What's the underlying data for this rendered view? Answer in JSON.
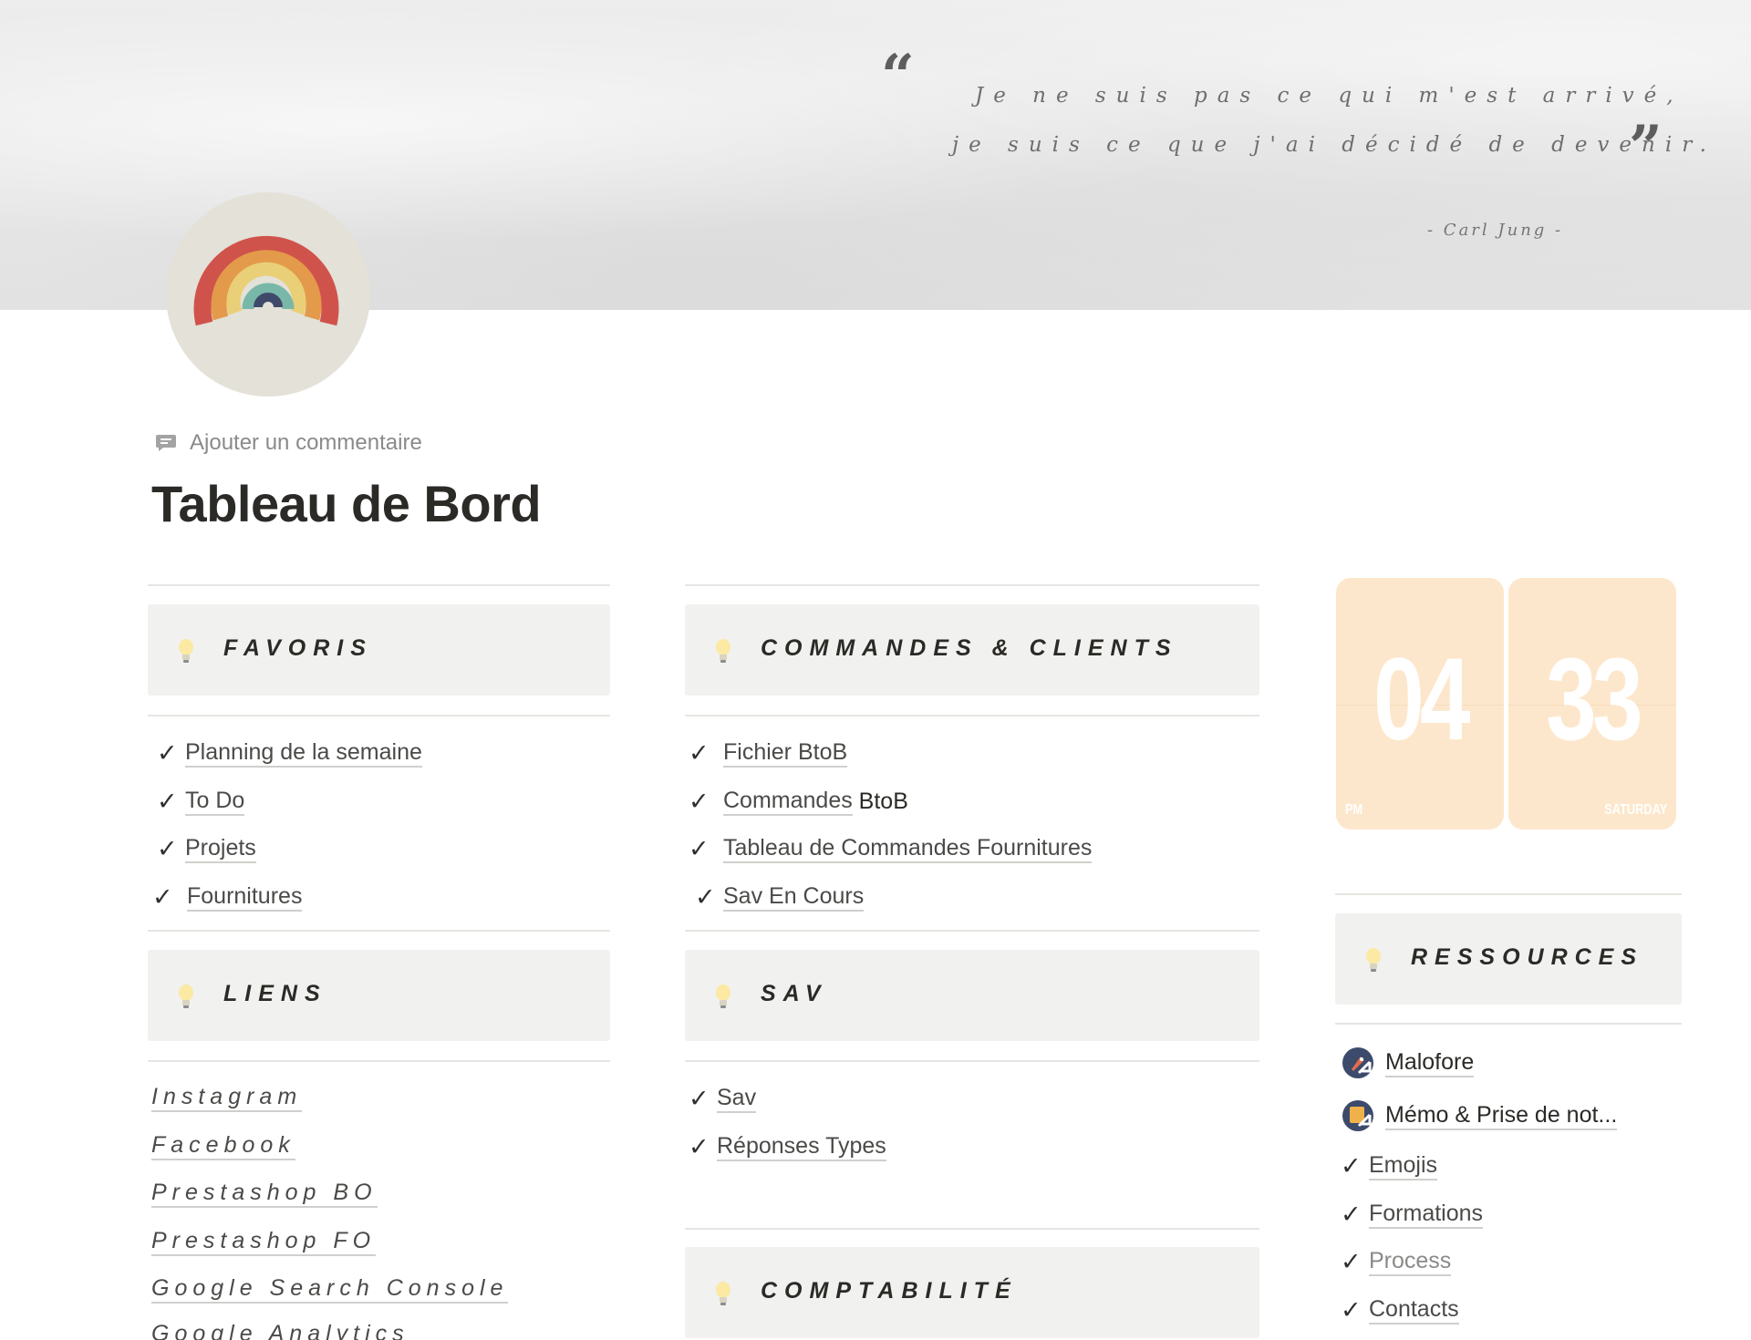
{
  "cover": {
    "quote_line1": "Je ne suis pas ce qui m'est arrivé,",
    "quote_line2": "je suis ce que j'ai décidé de devenir.",
    "quote_author": "- Carl Jung -",
    "quote_open": "“",
    "quote_close": "”"
  },
  "page": {
    "icon": "rainbow-icon",
    "comment_label": "Ajouter un commentaire",
    "title": "Tableau de Bord"
  },
  "favoris": {
    "title": "FAVORIS",
    "items": [
      "Planning de la semaine",
      "To Do",
      "Projets",
      "Fournitures"
    ]
  },
  "liens": {
    "title": "LIENS",
    "items": [
      "Instagram",
      "Facebook",
      "Prestashop BO",
      "Prestashop FO",
      "Google Search Console",
      "Google Analytics"
    ]
  },
  "commandes": {
    "title": "COMMANDES & CLIENTS",
    "items": [
      {
        "link": "Fichier BtoB",
        "suffix": ""
      },
      {
        "link": "Commandes",
        "suffix": " BtoB"
      },
      {
        "link": "Tableau de Commandes Fournitures",
        "suffix": ""
      },
      {
        "link": "Sav En Cours",
        "suffix": ""
      }
    ]
  },
  "sav": {
    "title": "SAV",
    "items": [
      "Sav",
      "Réponses Types"
    ]
  },
  "comptabilite": {
    "title": "COMPTABILITÉ"
  },
  "clock": {
    "hours": "04",
    "minutes": "33",
    "period": "PM",
    "day": "SATURDAY",
    "card_color": "#fde7cc"
  },
  "ressources": {
    "title": "RESSOURCES",
    "pages": [
      {
        "label": "Malofore",
        "icon": "rocket-page-icon"
      },
      {
        "label": "Mémo & Prise de not...",
        "icon": "note-page-icon"
      }
    ],
    "items": [
      "Emojis",
      "Formations",
      "Process",
      "Contacts"
    ]
  },
  "check_glyph": "✓"
}
